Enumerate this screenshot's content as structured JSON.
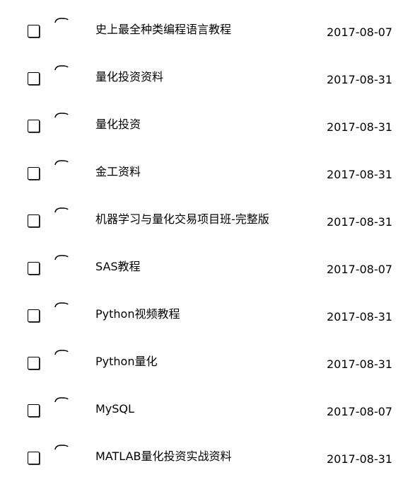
{
  "files": [
    {
      "name": "史上最全种类编程语言教程",
      "date": "2017-08-07"
    },
    {
      "name": "量化投资资料",
      "date": "2017-08-31"
    },
    {
      "name": "量化投资",
      "date": "2017-08-31"
    },
    {
      "name": "金工资料",
      "date": "2017-08-31"
    },
    {
      "name": "机器学习与量化交易项目班-完整版",
      "date": "2017-08-31"
    },
    {
      "name": "SAS教程",
      "date": "2017-08-07"
    },
    {
      "name": "Python视频教程",
      "date": "2017-08-31"
    },
    {
      "name": "Python量化",
      "date": "2017-08-31"
    },
    {
      "name": "MySQL",
      "date": "2017-08-07"
    },
    {
      "name": "MATLAB量化投资实战资料",
      "date": "2017-08-31"
    }
  ],
  "icons": {
    "checkbox": "checkbox-icon",
    "folder": "folder-icon"
  }
}
